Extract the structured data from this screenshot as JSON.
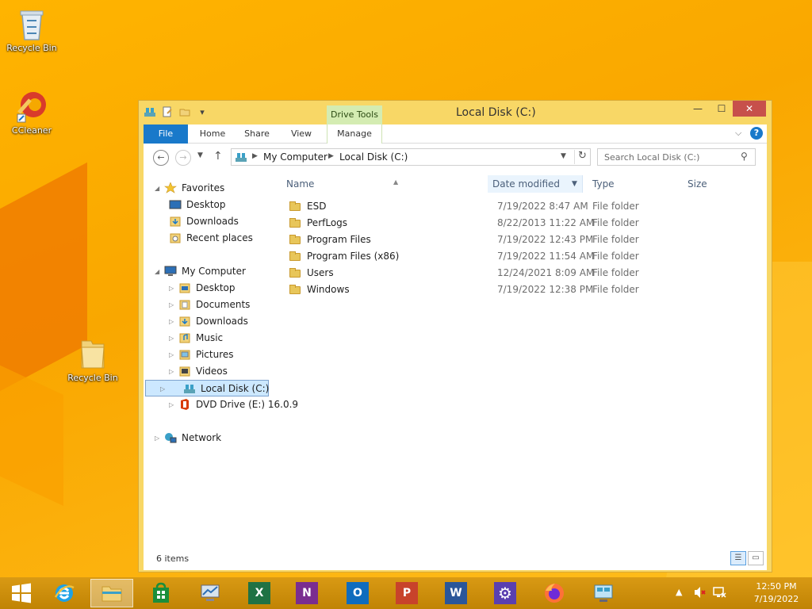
{
  "desktop": {
    "icons": [
      {
        "label": "Recycle Bin"
      },
      {
        "label": "CCleaner"
      },
      {
        "label": "Recycle Bin"
      }
    ]
  },
  "window": {
    "title": "Local Disk (C:)",
    "contextual_tab": "Drive Tools",
    "controls": {
      "minimize": "—",
      "maximize": "☐",
      "close": "✕"
    }
  },
  "ribbon": {
    "tabs": [
      "File",
      "Home",
      "Share",
      "View",
      "Manage"
    ],
    "help": "?"
  },
  "address": {
    "segments": [
      "My Computer",
      "Local Disk (C:)"
    ],
    "search_placeholder": "Search Local Disk (C:)"
  },
  "navigation": {
    "favorites_label": "Favorites",
    "favorites": [
      "Desktop",
      "Downloads",
      "Recent places"
    ],
    "computer_label": "My Computer",
    "computer": [
      "Desktop",
      "Documents",
      "Downloads",
      "Music",
      "Pictures",
      "Videos",
      "Local Disk (C:)",
      "DVD Drive (E:) 16.0.9"
    ],
    "network_label": "Network"
  },
  "columns": {
    "name": "Name",
    "date": "Date modified",
    "type": "Type",
    "size": "Size"
  },
  "files": [
    {
      "name": "ESD",
      "date": "7/19/2022 8:47 AM",
      "type": "File folder"
    },
    {
      "name": "PerfLogs",
      "date": "8/22/2013 11:22 AM",
      "type": "File folder"
    },
    {
      "name": "Program Files",
      "date": "7/19/2022 12:43 PM",
      "type": "File folder"
    },
    {
      "name": "Program Files (x86)",
      "date": "7/19/2022 11:54 AM",
      "type": "File folder"
    },
    {
      "name": "Users",
      "date": "12/24/2021 8:09 AM",
      "type": "File folder"
    },
    {
      "name": "Windows",
      "date": "7/19/2022 12:38 PM",
      "type": "File folder"
    }
  ],
  "status": {
    "item_count": "6 items"
  },
  "taskbar": {
    "apps": [
      {
        "icon": "ie-icon"
      },
      {
        "icon": "file-explorer-icon"
      },
      {
        "icon": "store-icon"
      },
      {
        "icon": "remote-desktop-icon"
      },
      {
        "icon": "excel-icon",
        "glyph": "X"
      },
      {
        "icon": "onenote-icon",
        "glyph": "N"
      },
      {
        "icon": "outlook-icon",
        "glyph": "O"
      },
      {
        "icon": "powerpoint-icon",
        "glyph": "P"
      },
      {
        "icon": "word-icon",
        "glyph": "W"
      },
      {
        "icon": "settings-icon"
      },
      {
        "icon": "firefox-icon"
      },
      {
        "icon": "control-panel-icon"
      }
    ],
    "time": "12:50 PM",
    "date": "7/19/2022"
  },
  "colors": {
    "accent": "#1979ca",
    "excel": "#1f7244",
    "onenote": "#7a2d90",
    "outlook": "#0f6cbd",
    "powerpoint": "#c8432b",
    "word": "#2a5699",
    "settings": "#5a3fb0"
  }
}
